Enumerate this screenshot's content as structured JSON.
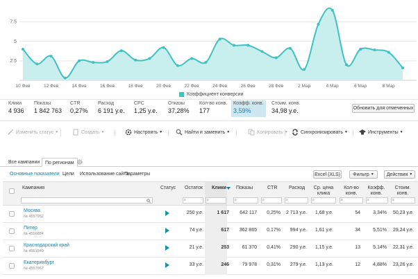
{
  "chart_data": {
    "type": "area",
    "x": [
      "10 Фев",
      "11 Фев",
      "12 Фев",
      "13 Фев",
      "14 Фев",
      "15 Фев",
      "16 Фев",
      "17 Фев",
      "18 Фев",
      "19 Фев",
      "20 Фев",
      "21 Фев",
      "22 Фев",
      "23 Фев",
      "24 Фев",
      "25 Фев",
      "26 Фев",
      "27 Фев",
      "28 Фев",
      "1 Мар",
      "2 Мар",
      "3 Мар",
      "4 Мар",
      "5 Мар",
      "6 Мар",
      "7 Мар",
      "8 Мар",
      "9 Мар"
    ],
    "series": [
      {
        "name": "Коэффициент конверсии",
        "values": [
          4.0,
          2.1,
          3.1,
          0.3,
          2.5,
          2.3,
          2.4,
          3.8,
          2.6,
          2.8,
          4.2,
          1.9,
          2.8,
          2.3,
          5.3,
          4.5,
          4.5,
          3.7,
          2.9,
          4.1,
          1.4,
          7.2,
          9.0,
          2.0,
          4.0,
          3.9,
          3.6,
          1.6
        ]
      }
    ],
    "xticks": [
      "10 Фев",
      "12 Фев",
      "14 Фев",
      "16 Фев",
      "18 Фев",
      "20 Фев",
      "22 Фев",
      "24 Фев",
      "26 Фев",
      "28 Фев",
      "2 Мар",
      "4 Мар",
      "6 Мар",
      "8 Мар"
    ],
    "yticks": [
      "2.5",
      "5",
      "7.5"
    ],
    "ylim": [
      0,
      9.6
    ],
    "grid": true,
    "legend": "bottom",
    "color": "#3fc1c1"
  },
  "metrics": [
    {
      "label": "Клики",
      "value": "4 936"
    },
    {
      "label": "Показы",
      "value": "1 842 763"
    },
    {
      "label": "CTR",
      "value": "0,27%"
    },
    {
      "label": "Расход",
      "value": "6 191 у.е."
    },
    {
      "label": "CPC",
      "value": "1,25 у.е."
    },
    {
      "label": "Отказы",
      "value": "37,28%"
    },
    {
      "label": "Кол-во конв.",
      "value": "177"
    },
    {
      "label": "Коэфф. конв.",
      "value": "3,59%"
    },
    {
      "label": "Стоим. конв.",
      "value": "34,98 у.е."
    }
  ],
  "show_selected_label": "Обновить для отмеченных",
  "toolbar": {
    "change_status": "Изменить статус",
    "create": "Создать",
    "configure": "Настроить",
    "find_replace": "Найти и заменить",
    "copy": "Копировать",
    "sync": "Синхронизировать",
    "tools": "Инструменты"
  },
  "tabs": {
    "all": "Все кампании",
    "regions": "По регионам"
  },
  "subtabs": {
    "main": "Основные показатели",
    "goals": "Цели",
    "usage": "Использование сайта",
    "params": "Параметры"
  },
  "buttons": {
    "excel": "Excel (XLS)",
    "filter": "Фильтр",
    "actions": "Действия"
  },
  "table": {
    "headers": {
      "campaign": "Кампания",
      "status": "Статус",
      "balance": "Остаток",
      "clicks": "Клики",
      "impressions": "Показы",
      "ctr": "CTR",
      "spend": "Расход",
      "avg_cpc": "Ср. цена клика",
      "conv_count": "Кол-во конв.",
      "conv_rate": "Коэфф. конв.",
      "conv_cost": "Стоим. конв."
    },
    "filter_symbol": "≥",
    "rows": [
      {
        "name": "Москва",
        "id": "№ 4557952",
        "balance": "250 у.е.",
        "clicks": "1 617",
        "impressions": "642 117",
        "ctr": "0,25%",
        "spend": "2 713 у.е.",
        "avg_cpc": "1,68 у.е.",
        "conv_count": "54",
        "conv_rate": "3,34%",
        "conv_cost": "50,23 у.е."
      },
      {
        "name": "Питер",
        "id": "№ 4556884",
        "balance": "74 у.е.",
        "clicks": "617",
        "impressions": "362 865",
        "ctr": "0,17%",
        "spend": "994 у.е.",
        "avg_cpc": "1,61 у.е.",
        "conv_count": "34",
        "conv_rate": "5,51%",
        "conv_cost": "29,24 у.е."
      },
      {
        "name": "Краснодарский край",
        "id": "№ 4561549",
        "balance": "21 у.е.",
        "clicks": "253",
        "impressions": "61 370",
        "ctr": "0,41%",
        "spend": "290 у.е.",
        "avg_cpc": "1,15 у.е.",
        "conv_count": "13",
        "conv_rate": "5,14%",
        "conv_cost": "22,31 у.е."
      },
      {
        "name": "Екатеринбург",
        "id": "№ 4557967",
        "balance": "33 у.е.",
        "clicks": "246",
        "impressions": "79 978",
        "ctr": "0,31%",
        "spend": "279 у.е.",
        "avg_cpc": "1,13 у.е.",
        "conv_count": "12",
        "conv_rate": "4,88%",
        "conv_cost": "23,26 у.е."
      }
    ]
  }
}
